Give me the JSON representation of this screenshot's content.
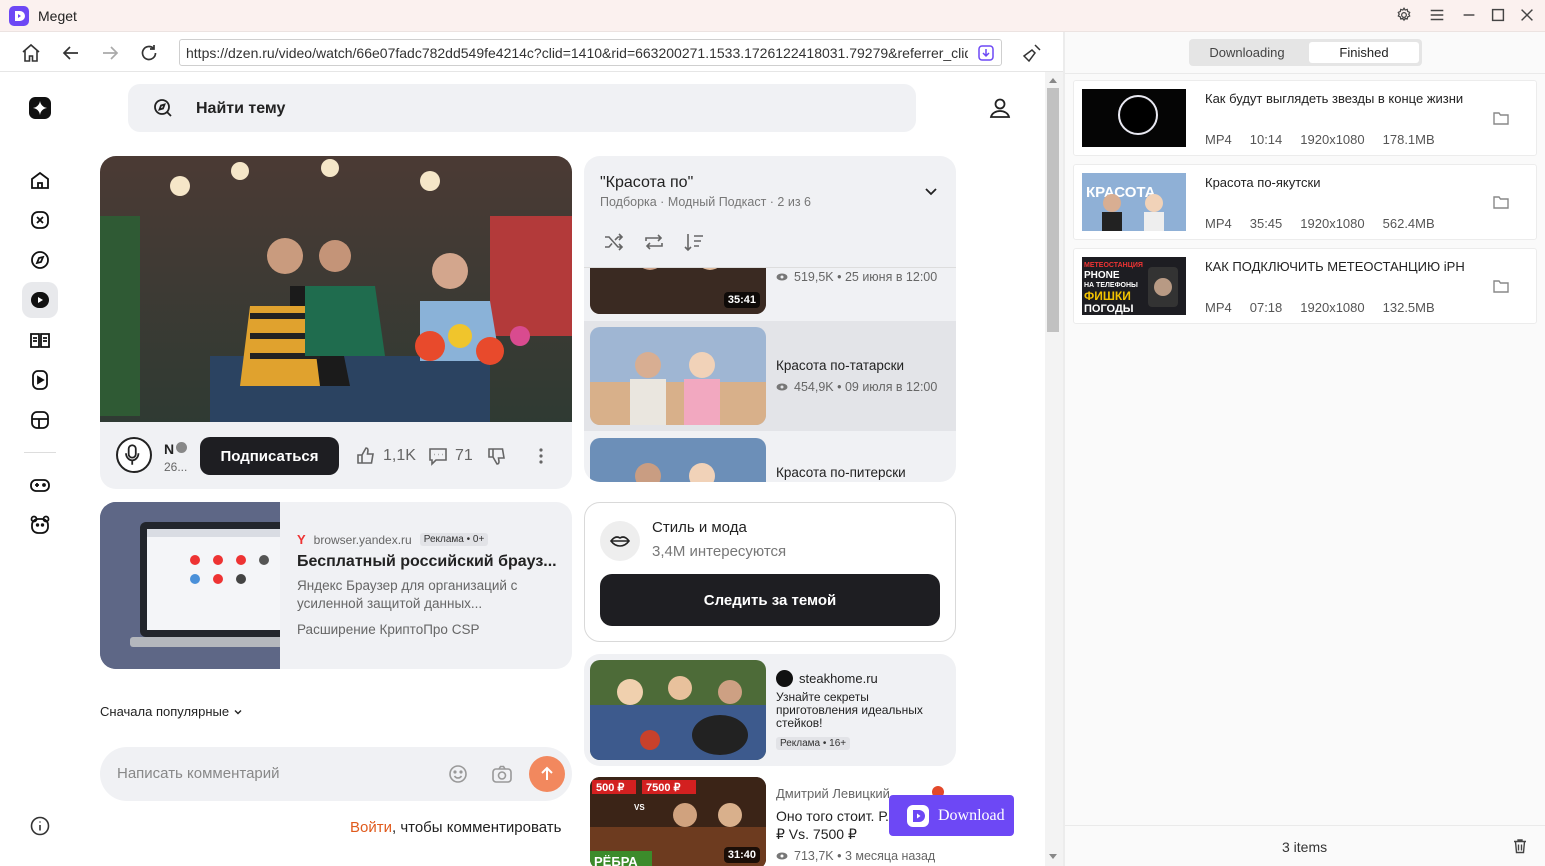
{
  "app": {
    "title": "Meget"
  },
  "browser": {
    "url": "https://dzen.ru/video/watch/66e07fadc782dd549fe4214c?clid=1410&rid=663200271.1533.1726122418031.79279&referrer_clid"
  },
  "search": {
    "placeholder": "Найти тему"
  },
  "video": {
    "channel_name": "N",
    "channel_subs": "26...",
    "subscribe_label": "Подписаться",
    "likes": "1,1K",
    "comments": "71"
  },
  "playlist": {
    "title": "\"Красота по\"",
    "subtitle": "Подборка · Модный Подкаст · 2 из 6",
    "items": [
      {
        "title": "",
        "views": "519,5K • 25 июня в 12:00",
        "duration": "35:41"
      },
      {
        "title": "Красота по-татарски",
        "views": "454,9K • 09 июля в 12:00",
        "duration": ""
      },
      {
        "title": "Красота по-питерски",
        "views": "",
        "duration": ""
      }
    ]
  },
  "ad": {
    "domain": "browser.yandex.ru",
    "badge": "Реклама • 0+",
    "title": "Бесплатный российский брауз...",
    "description": "Яндекс Браузер для организаций с усиленной защитой данных...",
    "link": "Расширение КриптоПро CSP"
  },
  "topic": {
    "title": "Стиль и мода",
    "followers": "3,4M интересуются",
    "follow_label": "Следить за темой"
  },
  "comments": {
    "sort_label": "Сначала популярные",
    "placeholder": "Написать комментарий",
    "login_link": "Войти",
    "login_rest": ", чтобы комментировать"
  },
  "sponsored": {
    "domain": "steakhome.ru",
    "description": "Узнайте секреты приготовления идеальных стейков!",
    "badge": "Реклама • 16+"
  },
  "next_video": {
    "author": "Дмитрий Левицкий",
    "title": "Оно того стоит. Р... 500 ₽ Vs. 7500 ₽",
    "meta": "713,7K • 3 месяца назад",
    "duration": "31:40",
    "thumb_labels": [
      "500 ₽",
      "7500 ₽",
      "VS",
      "РЁБРА"
    ]
  },
  "download_button": {
    "label": "Download"
  },
  "panel": {
    "tabs": {
      "downloading": "Downloading",
      "finished": "Finished"
    },
    "items": [
      {
        "title": "Как будут выглядеть звезды в конце жизни",
        "format": "MP4",
        "duration": "10:14",
        "resolution": "1920x1080",
        "size": "178.1MB"
      },
      {
        "title": "Красота по-якутски",
        "format": "MP4",
        "duration": "35:45",
        "resolution": "1920x1080",
        "size": "562.4MB"
      },
      {
        "title": "КАК ПОДКЛЮЧИТЬ МЕТЕОСТАНЦИЮ iPHC",
        "format": "MP4",
        "duration": "07:18",
        "resolution": "1920x1080",
        "size": "132.5MB"
      }
    ],
    "thumb_labels": {
      "item2": "КРАСОТА",
      "item3": [
        "МЕТЕОСТАНЦИЯ",
        "PHONE",
        "НА ТЕЛЕФОНЫ",
        "ФИШКИ",
        "ПОГОДЫ"
      ]
    },
    "count": "3 items"
  },
  "colors": {
    "accent": "#6d48f5",
    "send": "#f2885e",
    "login": "#e05a1c",
    "dark_button": "#1e1e22"
  }
}
